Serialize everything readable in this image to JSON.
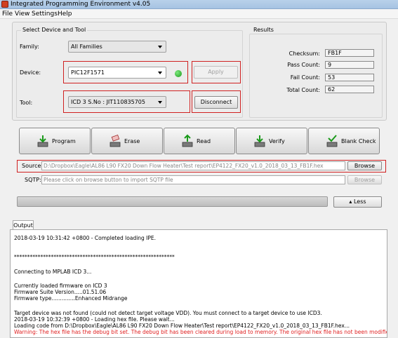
{
  "window": {
    "title": "Integrated Programming Environment v4.05"
  },
  "menu": [
    "File",
    "View",
    "Settings",
    "Help"
  ],
  "select_group": {
    "title": "Select Device and Tool",
    "family_label": "Family:",
    "family_value": "All Families",
    "device_label": "Device:",
    "device_value": "PIC12F1571",
    "apply_label": "Apply",
    "tool_label": "Tool:",
    "tool_value": "ICD 3 S.No : JIT110835705",
    "disconnect_label": "Disconnect",
    "status_color": "#1a9a1a"
  },
  "results": {
    "title": "Results",
    "items": [
      {
        "label": "Checksum:",
        "value": "FB1F"
      },
      {
        "label": "Pass Count:",
        "value": "9"
      },
      {
        "label": "Fail Count:",
        "value": "53"
      },
      {
        "label": "Total Count:",
        "value": "62"
      }
    ]
  },
  "actions": [
    {
      "label": "Program",
      "icon": "program-icon"
    },
    {
      "label": "Erase",
      "icon": "erase-icon"
    },
    {
      "label": "Read",
      "icon": "read-icon"
    },
    {
      "label": "Verify",
      "icon": "verify-icon"
    },
    {
      "label": "Blank Check",
      "icon": "blank-check-icon"
    }
  ],
  "source": {
    "label": "Source:",
    "value": "D:\\Dropbox\\Eagle\\AL86 L90 FX20 Down Flow Heater\\Test report\\EP4122_FX20_v1.0_2018_03_13_FB1F.hex",
    "browse_label": "Browse"
  },
  "sqtp": {
    "label": "SQTP:",
    "placeholder": "Please click on browse button to import SQTP file",
    "browse_label": "Browse"
  },
  "less_label": "Less",
  "output": {
    "tab_label": "Output",
    "lines": [
      {
        "text": "2018-03-19 10:31:42 +0800 - Completed loading IPE.",
        "warn": false
      },
      {
        "text": "*************************************************************",
        "warn": false
      },
      {
        "text": "Connecting to MPLAB ICD 3...",
        "warn": false
      },
      {
        "text": "Currently loaded firmware on ICD 3",
        "warn": false
      },
      {
        "text": "Firmware Suite Version.....01.51.06",
        "warn": false
      },
      {
        "text": "Firmware type..............Enhanced Midrange",
        "warn": false
      },
      {
        "text": "Target device was not found (could not detect target voltage VDD). You must connect to a target device to use ICD3.",
        "warn": false
      },
      {
        "text": "2018-03-19 10:32:39 +0800 - Loading hex file. Please wait...",
        "warn": false
      },
      {
        "text": "Loading code from D:\\Dropbox\\Eagle\\AL86 L90 FX20 Down Flow Heater\\Test report\\EP4122_FX20_v1.0_2018_03_13_FB1F.hex...",
        "warn": false
      },
      {
        "text": "Warning: The hex file has the debug bit set.  The debug bit has been cleared during load to memory.  The original hex file has not been modified.",
        "warn": true
      }
    ]
  }
}
